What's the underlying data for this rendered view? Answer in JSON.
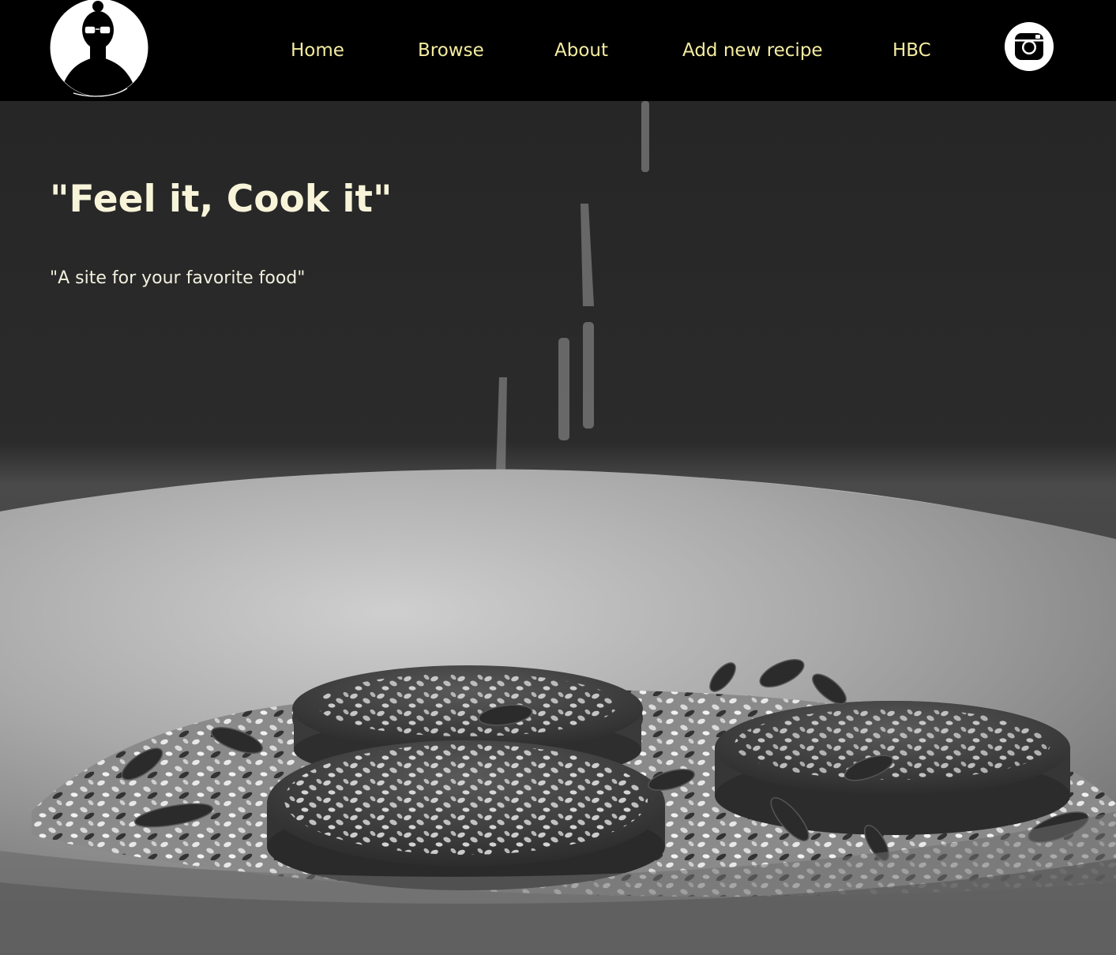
{
  "navbar": {
    "logo_alt": "profile avatar logo",
    "links": [
      {
        "label": "Home"
      },
      {
        "label": "Browse"
      },
      {
        "label": "About"
      },
      {
        "label": "Add new recipe"
      },
      {
        "label": "HBC"
      }
    ],
    "social_icon": "instagram-icon"
  },
  "hero": {
    "title": "\"Feel it, Cook it\"",
    "subtitle": "\"A site for your favorite food\"",
    "image": "monochrome photo of a bowl with sesame-topped rounds and seeds"
  },
  "colors": {
    "nav_background": "#000000",
    "nav_link": "#f4eda0",
    "hero_text": "#f7f4d9"
  }
}
